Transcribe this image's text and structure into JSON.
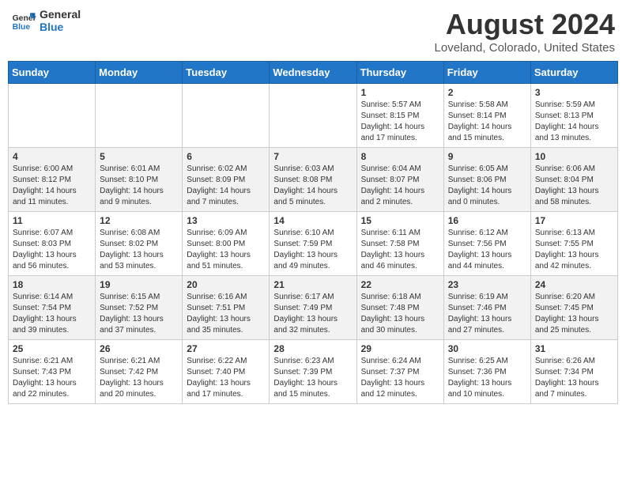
{
  "logo": {
    "line1": "General",
    "line2": "Blue"
  },
  "title": "August 2024",
  "subtitle": "Loveland, Colorado, United States",
  "days_of_week": [
    "Sunday",
    "Monday",
    "Tuesday",
    "Wednesday",
    "Thursday",
    "Friday",
    "Saturday"
  ],
  "weeks": [
    [
      {
        "day": "",
        "content": ""
      },
      {
        "day": "",
        "content": ""
      },
      {
        "day": "",
        "content": ""
      },
      {
        "day": "",
        "content": ""
      },
      {
        "day": "1",
        "content": "Sunrise: 5:57 AM\nSunset: 8:15 PM\nDaylight: 14 hours\nand 17 minutes."
      },
      {
        "day": "2",
        "content": "Sunrise: 5:58 AM\nSunset: 8:14 PM\nDaylight: 14 hours\nand 15 minutes."
      },
      {
        "day": "3",
        "content": "Sunrise: 5:59 AM\nSunset: 8:13 PM\nDaylight: 14 hours\nand 13 minutes."
      }
    ],
    [
      {
        "day": "4",
        "content": "Sunrise: 6:00 AM\nSunset: 8:12 PM\nDaylight: 14 hours\nand 11 minutes."
      },
      {
        "day": "5",
        "content": "Sunrise: 6:01 AM\nSunset: 8:10 PM\nDaylight: 14 hours\nand 9 minutes."
      },
      {
        "day": "6",
        "content": "Sunrise: 6:02 AM\nSunset: 8:09 PM\nDaylight: 14 hours\nand 7 minutes."
      },
      {
        "day": "7",
        "content": "Sunrise: 6:03 AM\nSunset: 8:08 PM\nDaylight: 14 hours\nand 5 minutes."
      },
      {
        "day": "8",
        "content": "Sunrise: 6:04 AM\nSunset: 8:07 PM\nDaylight: 14 hours\nand 2 minutes."
      },
      {
        "day": "9",
        "content": "Sunrise: 6:05 AM\nSunset: 8:06 PM\nDaylight: 14 hours\nand 0 minutes."
      },
      {
        "day": "10",
        "content": "Sunrise: 6:06 AM\nSunset: 8:04 PM\nDaylight: 13 hours\nand 58 minutes."
      }
    ],
    [
      {
        "day": "11",
        "content": "Sunrise: 6:07 AM\nSunset: 8:03 PM\nDaylight: 13 hours\nand 56 minutes."
      },
      {
        "day": "12",
        "content": "Sunrise: 6:08 AM\nSunset: 8:02 PM\nDaylight: 13 hours\nand 53 minutes."
      },
      {
        "day": "13",
        "content": "Sunrise: 6:09 AM\nSunset: 8:00 PM\nDaylight: 13 hours\nand 51 minutes."
      },
      {
        "day": "14",
        "content": "Sunrise: 6:10 AM\nSunset: 7:59 PM\nDaylight: 13 hours\nand 49 minutes."
      },
      {
        "day": "15",
        "content": "Sunrise: 6:11 AM\nSunset: 7:58 PM\nDaylight: 13 hours\nand 46 minutes."
      },
      {
        "day": "16",
        "content": "Sunrise: 6:12 AM\nSunset: 7:56 PM\nDaylight: 13 hours\nand 44 minutes."
      },
      {
        "day": "17",
        "content": "Sunrise: 6:13 AM\nSunset: 7:55 PM\nDaylight: 13 hours\nand 42 minutes."
      }
    ],
    [
      {
        "day": "18",
        "content": "Sunrise: 6:14 AM\nSunset: 7:54 PM\nDaylight: 13 hours\nand 39 minutes."
      },
      {
        "day": "19",
        "content": "Sunrise: 6:15 AM\nSunset: 7:52 PM\nDaylight: 13 hours\nand 37 minutes."
      },
      {
        "day": "20",
        "content": "Sunrise: 6:16 AM\nSunset: 7:51 PM\nDaylight: 13 hours\nand 35 minutes."
      },
      {
        "day": "21",
        "content": "Sunrise: 6:17 AM\nSunset: 7:49 PM\nDaylight: 13 hours\nand 32 minutes."
      },
      {
        "day": "22",
        "content": "Sunrise: 6:18 AM\nSunset: 7:48 PM\nDaylight: 13 hours\nand 30 minutes."
      },
      {
        "day": "23",
        "content": "Sunrise: 6:19 AM\nSunset: 7:46 PM\nDaylight: 13 hours\nand 27 minutes."
      },
      {
        "day": "24",
        "content": "Sunrise: 6:20 AM\nSunset: 7:45 PM\nDaylight: 13 hours\nand 25 minutes."
      }
    ],
    [
      {
        "day": "25",
        "content": "Sunrise: 6:21 AM\nSunset: 7:43 PM\nDaylight: 13 hours\nand 22 minutes."
      },
      {
        "day": "26",
        "content": "Sunrise: 6:21 AM\nSunset: 7:42 PM\nDaylight: 13 hours\nand 20 minutes."
      },
      {
        "day": "27",
        "content": "Sunrise: 6:22 AM\nSunset: 7:40 PM\nDaylight: 13 hours\nand 17 minutes."
      },
      {
        "day": "28",
        "content": "Sunrise: 6:23 AM\nSunset: 7:39 PM\nDaylight: 13 hours\nand 15 minutes."
      },
      {
        "day": "29",
        "content": "Sunrise: 6:24 AM\nSunset: 7:37 PM\nDaylight: 13 hours\nand 12 minutes."
      },
      {
        "day": "30",
        "content": "Sunrise: 6:25 AM\nSunset: 7:36 PM\nDaylight: 13 hours\nand 10 minutes."
      },
      {
        "day": "31",
        "content": "Sunrise: 6:26 AM\nSunset: 7:34 PM\nDaylight: 13 hours\nand 7 minutes."
      }
    ]
  ]
}
